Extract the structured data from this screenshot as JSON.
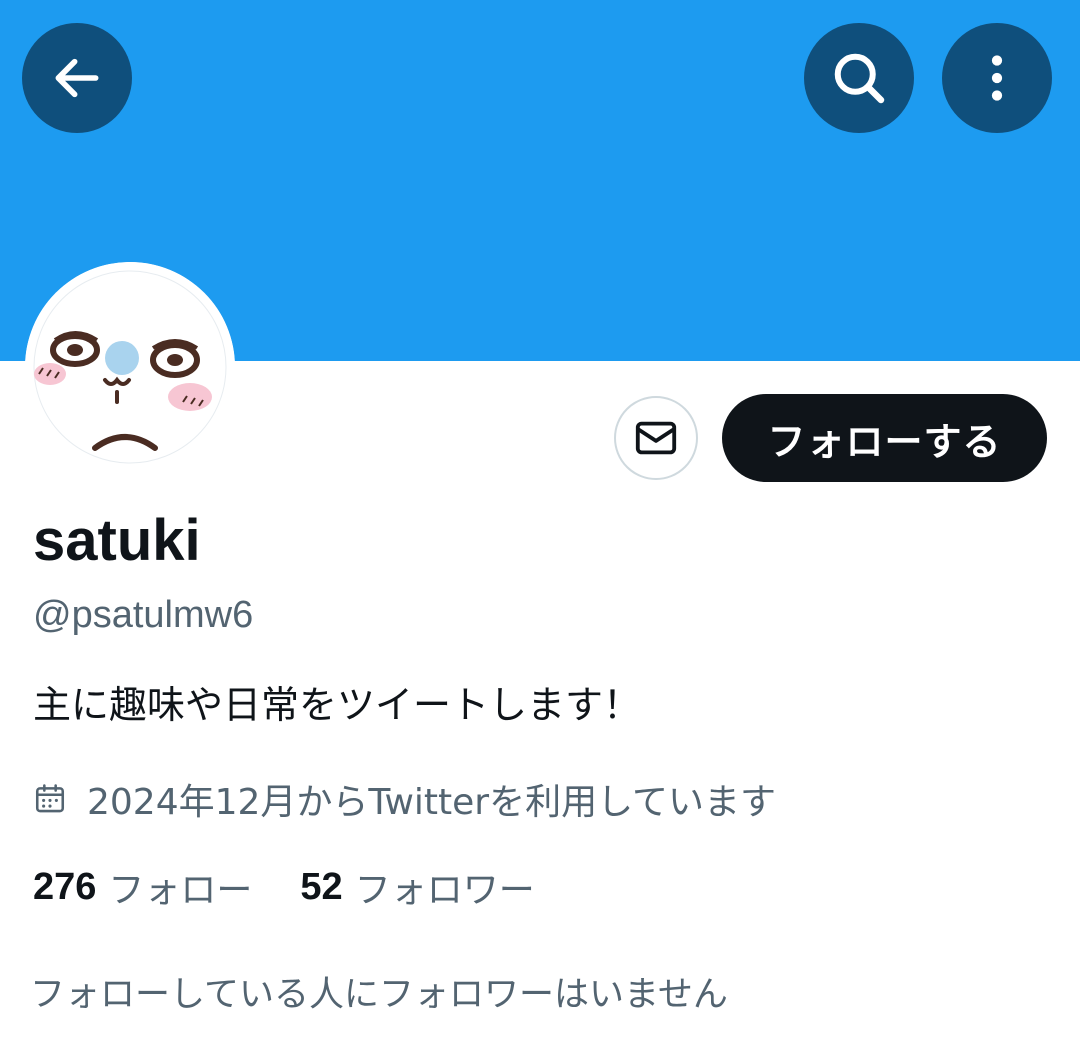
{
  "header": {
    "back_icon": "arrow-left-icon",
    "search_icon": "search-icon",
    "more_icon": "more-vertical-icon",
    "banner_color": "#1d9bf0"
  },
  "actions": {
    "message_icon": "envelope-icon",
    "follow_label": "フォローする"
  },
  "profile": {
    "display_name": "satuki",
    "handle": "@psatulmw6",
    "bio": "主に趣味や日常をツイートします！",
    "joined_icon": "calendar-icon",
    "joined": "2024年12月からTwitterを利用しています"
  },
  "stats": {
    "following_count": "276",
    "following_label": "フォロー",
    "followers_count": "52",
    "followers_label": "フォロワー"
  },
  "followers_you_follow": "フォローしている人にフォロワーはいません",
  "colors": {
    "primary_text": "#0f1419",
    "secondary_text": "#536471",
    "follow_button": "#0f1419"
  }
}
